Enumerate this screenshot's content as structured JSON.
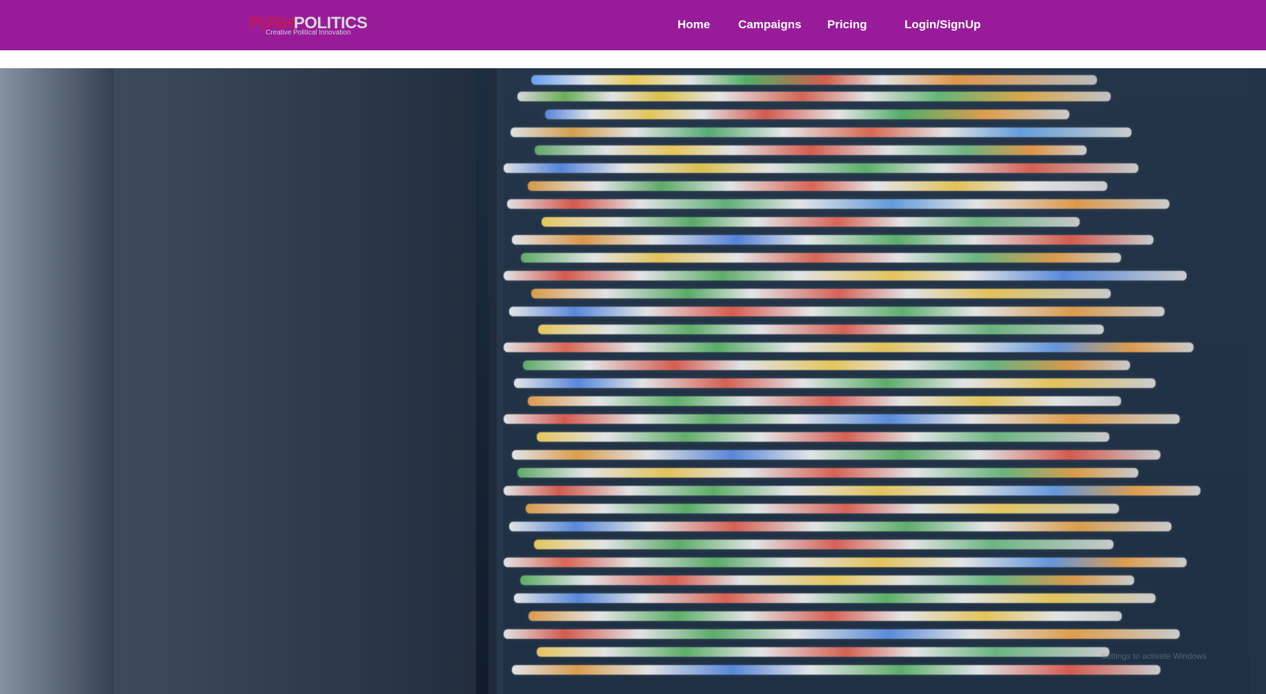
{
  "nav": {
    "logo_push": "PUSH",
    "logo_politics": "POLITICS",
    "logo_tagline": "Creative Political Innovation",
    "home": "Home",
    "campaigns": "Campaigns",
    "pricing": "Pricing",
    "login": "Login/SignUp"
  },
  "colors": {
    "nav_bg": "#981B9A",
    "logo_accent": "#C3184E"
  },
  "hero": {
    "overlay_text": "Settings to activate Windows"
  }
}
